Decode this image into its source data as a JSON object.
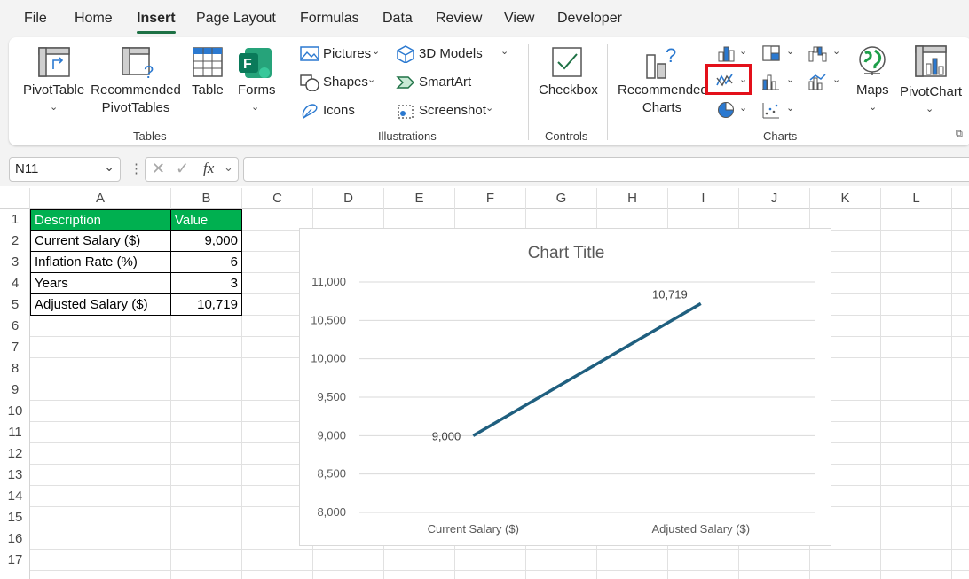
{
  "menu": {
    "tabs": [
      "File",
      "Home",
      "Insert",
      "Page Layout",
      "Formulas",
      "Data",
      "Review",
      "View",
      "Developer"
    ],
    "active": "Insert"
  },
  "ribbon": {
    "tables": {
      "label": "Tables",
      "pivottable": "PivotTable",
      "recommended_line1": "Recommended",
      "recommended_line2": "PivotTables",
      "table": "Table",
      "forms": "Forms"
    },
    "illustrations": {
      "label": "Illustrations",
      "pictures": "Pictures",
      "shapes": "Shapes",
      "icons": "Icons",
      "models3d": "3D Models",
      "smartart": "SmartArt",
      "screenshot": "Screenshot"
    },
    "controls": {
      "label": "Controls",
      "checkbox": "Checkbox"
    },
    "charts": {
      "label": "Charts",
      "recommended_line1": "Recommended",
      "recommended_line2": "Charts",
      "maps": "Maps",
      "pivotchart": "PivotChart"
    },
    "colors": {
      "highlight": "#e3101a",
      "accent": "#1e7145"
    }
  },
  "formula_bar": {
    "name_box": "N11",
    "fx": "fx",
    "formula": ""
  },
  "grid": {
    "columns": [
      "A",
      "B",
      "C",
      "D",
      "E",
      "F",
      "G",
      "H",
      "I",
      "J",
      "K",
      "L"
    ],
    "rows": [
      "1",
      "2",
      "3",
      "4",
      "5",
      "6",
      "7",
      "8",
      "9",
      "10",
      "11",
      "12",
      "13",
      "14",
      "15",
      "16",
      "17"
    ]
  },
  "table": {
    "header": [
      "Description",
      "Value"
    ],
    "rows": [
      [
        "Current Salary ($)",
        "9,000"
      ],
      [
        "Inflation Rate (%)",
        "6"
      ],
      [
        "Years",
        "3"
      ],
      [
        "Adjusted Salary ($)",
        "10,719"
      ]
    ],
    "header_color": "#00b050"
  },
  "chart_data": {
    "type": "line",
    "title": "Chart Title",
    "categories": [
      "Current Salary ($)",
      "Adjusted Salary ($)"
    ],
    "series": [
      {
        "values": [
          9000,
          10719
        ],
        "data_labels": [
          "9,000",
          "10,719"
        ]
      }
    ],
    "y_ticks": [
      "8,000",
      "8,500",
      "9,000",
      "9,500",
      "10,000",
      "10,500",
      "11,000"
    ],
    "ylim": [
      8000,
      11000
    ],
    "grid": true,
    "legend": "none",
    "line_color": "#1f5f7f"
  }
}
